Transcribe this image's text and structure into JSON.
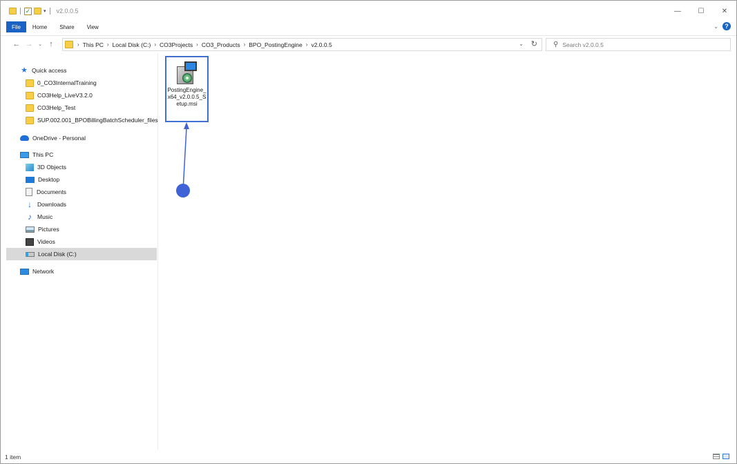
{
  "window": {
    "title": "v2.0.0.5",
    "controls": [
      "minimize",
      "maximize",
      "close"
    ]
  },
  "ribbon": {
    "tabs": [
      "File",
      "Home",
      "Share",
      "View"
    ]
  },
  "address": {
    "breadcrumb": [
      "This PC",
      "Local Disk (C:)",
      "CO3Projects",
      "CO3_Products",
      "BPO_PostingEngine",
      "v2.0.0.5"
    ]
  },
  "search": {
    "placeholder": "Search v2.0.0.5"
  },
  "navpane": {
    "quick_access_label": "Quick access",
    "quick_access": [
      "0_CO3InternalTraining",
      "CO3Help_LiveV3.2.0",
      "CO3Help_Test",
      "SUP.002.001_BPOBillingBatchScheduler_files"
    ],
    "onedrive": "OneDrive - Personal",
    "this_pc": "This PC",
    "this_pc_items": [
      "3D Objects",
      "Desktop",
      "Documents",
      "Downloads",
      "Music",
      "Pictures",
      "Videos",
      "Local Disk (C:)"
    ],
    "network": "Network"
  },
  "content": {
    "files": [
      {
        "name": "PostingEngine_x64_v2.0.0.5_Setup.msi",
        "icon": "msi-installer-icon",
        "selected": true
      }
    ]
  },
  "status": {
    "item_count": "1 item"
  },
  "colors": {
    "accent": "#1a63c4",
    "highlight_border": "#3f6fd1",
    "pointer": "#3f62d6",
    "folder": "#f7ce46"
  }
}
